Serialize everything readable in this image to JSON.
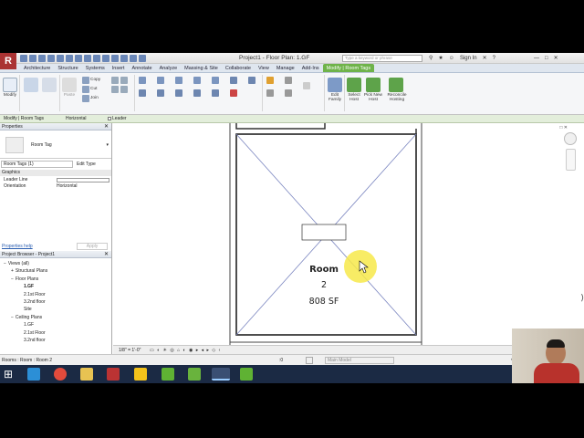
{
  "titlebar": {
    "logo": "R",
    "title": "Project1 - Floor Plan: 1.GF",
    "search_placeholder": "Type a keyword or phrase",
    "sign_in": "Sign In"
  },
  "ribbon_tabs": [
    "Architecture",
    "Structure",
    "Systems",
    "Insert",
    "Annotate",
    "Analyze",
    "Massing & Site",
    "Collaborate",
    "View",
    "Manage",
    "Add-Ins",
    "Modify | Room Tags"
  ],
  "ribbon": {
    "modify": "Modify",
    "paste": "Paste",
    "copy": "Copy",
    "cut": "Cut",
    "join": "Join",
    "edit_family": "Edit\nFamily",
    "select_host": "Select\nHost",
    "pick_new_host": "Pick New\nHost",
    "reconcile_hosting": "Reconcile\nHosting"
  },
  "options_bar": {
    "context": "Modify | Room Tags",
    "orientation": "Horizontal",
    "leader": "Leader"
  },
  "properties": {
    "title": "Properties",
    "type_name": "Room Tag",
    "selector": "Room Tags (1)",
    "edit_type": "Edit Type",
    "group": "Graphics",
    "rows": [
      {
        "label": "Leader Line",
        "value": ""
      },
      {
        "label": "Orientation",
        "value": "Horizontal"
      }
    ],
    "help": "Properties help",
    "apply": "Apply"
  },
  "browser": {
    "title": "Project Browser - Project1",
    "items": [
      {
        "label": "Views (all)",
        "indent": 0,
        "toggle": "−"
      },
      {
        "label": "Structural Plans",
        "indent": 1,
        "toggle": "+"
      },
      {
        "label": "Floor Plans",
        "indent": 1,
        "toggle": "−"
      },
      {
        "label": "1.GF",
        "indent": 2,
        "toggle": "",
        "bold": true
      },
      {
        "label": "2.1st Floor",
        "indent": 2,
        "toggle": ""
      },
      {
        "label": "3.2nd floor",
        "indent": 2,
        "toggle": ""
      },
      {
        "label": "Site",
        "indent": 2,
        "toggle": ""
      },
      {
        "label": "Ceiling Plans",
        "indent": 1,
        "toggle": "−"
      },
      {
        "label": "1.GF",
        "indent": 2,
        "toggle": ""
      },
      {
        "label": "2.1st Floor",
        "indent": 2,
        "toggle": ""
      },
      {
        "label": "3.2nd floor",
        "indent": 2,
        "toggle": ""
      }
    ]
  },
  "drawing": {
    "room_name": "Room",
    "room_number": "2",
    "room_area": "808 SF"
  },
  "view_status": {
    "scale": "1/8\" = 1'-0\""
  },
  "status_bar": {
    "text": "Rooms : Room : Room 2",
    "zero": ":0",
    "model": "Main Model"
  },
  "colors": {
    "context_tab": "#6fb34a",
    "highlight": "#f7e94a",
    "revit_red": "#a33"
  }
}
